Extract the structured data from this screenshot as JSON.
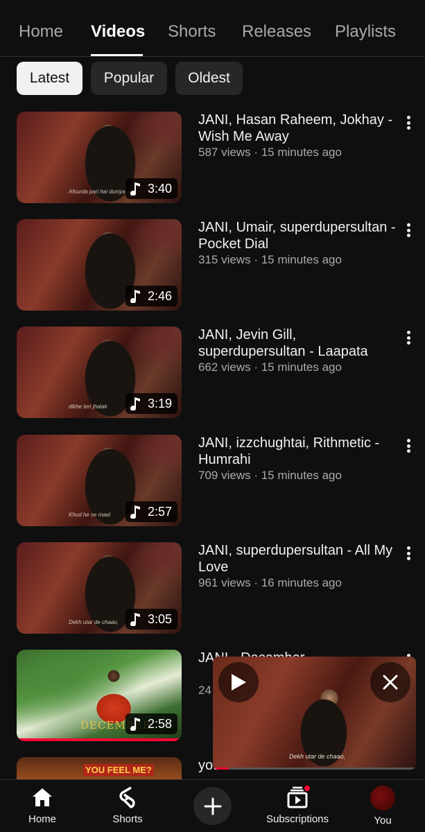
{
  "tabs": {
    "items": [
      "Home",
      "Videos",
      "Shorts",
      "Releases",
      "Playlists"
    ],
    "active": "Videos"
  },
  "chips": [
    "Latest",
    "Popular",
    "Oldest"
  ],
  "selected_chip": "Latest",
  "videos": [
    {
      "title": "JANI, Hasan Raheem, Jokhay - Wish Me Away",
      "views": "587 views",
      "age": "15 minutes ago",
      "duration": "3:40",
      "thumb_caption": "Afsurda pari hai duniya"
    },
    {
      "title": "JANI, Umair, superdupersultan - Pocket Dial",
      "views": "315 views",
      "age": "15 minutes ago",
      "duration": "2:46",
      "thumb_caption": ""
    },
    {
      "title": "JANI, Jevin Gill, superdupersultan - Laapata",
      "views": "662 views",
      "age": "15 minutes ago",
      "duration": "3:19",
      "thumb_caption": "dikhe teri jhalak"
    },
    {
      "title": "JANI, izzchughtai, Rithmetic - Humrahi",
      "views": "709 views",
      "age": "15 minutes ago",
      "duration": "2:57",
      "thumb_caption": "Khud he se mael"
    },
    {
      "title": "JANI, superdupersultan - All My Love",
      "views": "961 views",
      "age": "16 minutes ago",
      "duration": "3:05",
      "thumb_caption": "Dekh utar de chaao,"
    },
    {
      "title": "JANI - December",
      "views": "24",
      "age": "",
      "duration": "2:58",
      "thumb_caption": "DECEMBER",
      "progress": 1.0
    },
    {
      "title": "you",
      "views": "",
      "age": "",
      "duration": "",
      "thumb_caption": "YOU FEEL ME?"
    }
  ],
  "miniplayer": {
    "caption": "Dekh utar de chaao,",
    "play_icon": "play-icon",
    "close_icon": "close-icon",
    "progress": 0.08
  },
  "bottom_nav": {
    "home": "Home",
    "shorts": "Shorts",
    "subscriptions": "Subscriptions",
    "you": "You"
  },
  "colors": {
    "background": "#0f0f0f",
    "accent": "#ff0033",
    "chip": "#272727",
    "secondary_text": "#aaaaaa"
  }
}
